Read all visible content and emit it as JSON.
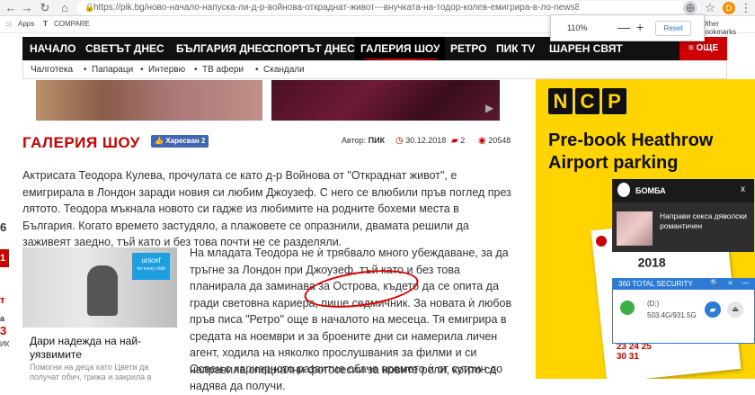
{
  "browser": {
    "url": "https://pik.bg/ново-начало-напуска-ли-д-р-войнова-откраднат-живот---внучката-на-тодор-колев-емигрира-в-ло-news807445.html",
    "bookmarks": {
      "apps": "Apps",
      "compare": "COMPARE",
      "other": "Other bookmarks"
    },
    "zoom": {
      "level": "110%",
      "minus": "—",
      "plus": "+",
      "reset": "Reset"
    },
    "profile_letter": "D"
  },
  "nav": {
    "items": [
      "НАЧАЛО",
      "СВЕТЪТ ДНЕС",
      "БЪЛГАРИЯ ДНЕС",
      "СПОРТЪТ ДНЕС",
      "ГАЛЕРИЯ ШОУ",
      "РЕТРО",
      "ПИК TV",
      "ШАРЕН СВЯТ"
    ],
    "more": "≡ ОЩЕ",
    "sub": [
      "Чалготека",
      "Папараци",
      "Интервю",
      "ТВ афери",
      "Скандали"
    ]
  },
  "article": {
    "section": "ГАЛЕРИЯ ШОУ",
    "like": "Харесван 2",
    "author_label": "Автор:",
    "author": "ПИК",
    "date": "30.12.2018",
    "comments": "2",
    "views": "20548",
    "para1": "Актрисата Теодора Кулева, прочулата се като д-р Войнова от \"Откраднат живот\", е емигрирала в Лондон заради новия си любим Джоузеф. С него се влюбили пръв поглед през лятото. Теодора мъкнала новото си гадже из любимите на родните бохеми места в България. Когато времето застудяло, а плажовете се опразнили, двамата решили да заживеят заедно, тъй като и без това почти не се разделяли.",
    "para2": "На младата Теодора не ѝ трябвало много убеждаване, за да тръгне за Лондон при Джоузеф, тъй като и без това планирала да заминава за Острова, където да се опита да гради световна кариера, пише седмичник. За новата ѝ любов пръв писа \"Ретро\" още в началото на месеца. Тя емигрира в средата на ноември и за броените дни си намерила личен агент, ходила на няколко прослушвания за филми и си направила специални фотосесии за новите роли, които се надява да получи.",
    "para3": "Освен с кариерното развитие обаче времето ѝ от сутрин до"
  },
  "related": {
    "title": "Дари надежда на най-уязвимите",
    "desc": "Помогни на деца като Цвети да получат обич, грижа и закрила в",
    "badge": "unicef",
    "badge_sub": "for every child"
  },
  "edge": {
    "num1": "6",
    "box": "1",
    "letter": "т",
    "num3": "3",
    "text": "ИК",
    "a": "a"
  },
  "ad": {
    "logo": [
      "N",
      "C",
      "P"
    ],
    "headline": "Pre-book Heathrow Airport parking",
    "year": "2018",
    "days": "23 24 25\n30 31"
  },
  "bomba": {
    "title": "БОМБА",
    "close": "x",
    "text": "Направи секса дяволски романтичен"
  },
  "security": {
    "title": "360 TOTAL SECURITY",
    "icons": "🔍 ≡ —",
    "drive": "(D:)",
    "size": "503.4G/931.5G"
  }
}
